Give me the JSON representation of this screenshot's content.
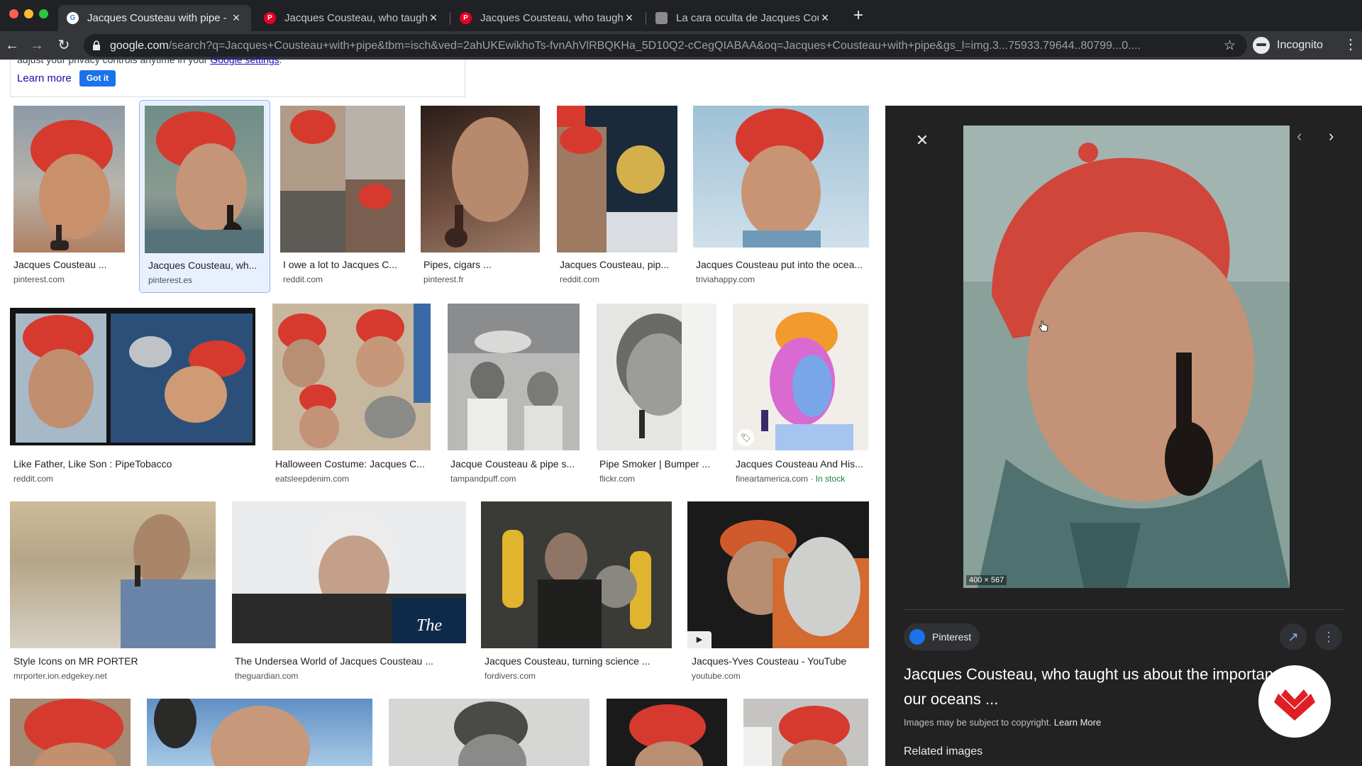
{
  "browser": {
    "tabs": [
      {
        "title": "Jacques Cousteau with pipe - Google Search",
        "favicon": "google-icon",
        "active": true
      },
      {
        "title": "Jacques Cousteau, who taught us about the importance of our oceans",
        "favicon": "pinterest-icon",
        "active": false
      },
      {
        "title": "Jacques Cousteau, who taught us about the importance of our oceans",
        "favicon": "pinterest-icon",
        "active": false
      },
      {
        "title": "La cara oculta de Jacques Cousteau",
        "favicon": "site-icon",
        "active": false
      }
    ],
    "new_tab_symbol": "+",
    "url_host": "google.com",
    "url_path": "/search?q=Jacques+Cousteau+with+pipe&tbm=isch&ved=2ahUKEwikhoTs-fvnAhVlRBQKHa_5D10Q2-cCegQIABAA&oq=Jacques+Cousteau+with+pipe&gs_l=img.3...75933.79644..80799...0....",
    "profile_label": "Incognito"
  },
  "notice": {
    "text_before_link": "adjust your privacy controls anytime in your ",
    "link_text": "Google settings",
    "text_after_link": ".",
    "learn_more": "Learn more",
    "got_it": "Got it"
  },
  "results": [
    {
      "caption": "Jacques Cousteau ...",
      "source": "pinterest.com",
      "selected": false
    },
    {
      "caption": "Jacques Cousteau, wh...",
      "source": "pinterest.es",
      "selected": true
    },
    {
      "caption": "I owe a lot to Jacques C...",
      "source": "reddit.com"
    },
    {
      "caption": "Pipes, cigars ...",
      "source": "pinterest.fr"
    },
    {
      "caption": "Jacques Cousteau, pip...",
      "source": "reddit.com"
    },
    {
      "caption": "Jacques Cousteau put into the ocea...",
      "source": "triviahappy.com"
    },
    {
      "caption": "Like Father, Like Son : PipeTobacco",
      "source": "reddit.com"
    },
    {
      "caption": "Halloween Costume: Jacques C...",
      "source": "eatsleepdenim.com"
    },
    {
      "caption": "Jacque Cousteau & pipe s...",
      "source": "tampandpuff.com"
    },
    {
      "caption": "Pipe Smoker | Bumper ...",
      "source": "flickr.com"
    },
    {
      "caption": "Jacques Cousteau And His...",
      "source": "fineartamerica.com",
      "stock": "In stock"
    },
    {
      "caption": "Style Icons on MR PORTER",
      "source": "mrporter.ion.edgekey.net"
    },
    {
      "caption": "The Undersea World of Jacques Cousteau ...",
      "source": "theguardian.com"
    },
    {
      "caption": "Jacques Cousteau, turning science ...",
      "source": "fordivers.com"
    },
    {
      "caption": "Jacques-Yves Cousteau - YouTube",
      "source": "youtube.com",
      "video": true
    }
  ],
  "panel": {
    "dimensions": "400 × 567",
    "source_name": "Pinterest",
    "title": "Jacques Cousteau, who taught us about the importance of our oceans ...",
    "copyright": "Images may be subject to copyright.",
    "learn_more": "Learn More",
    "related": "Related images"
  },
  "colors": {
    "link": "#1a0dab",
    "accent": "#1a73e8",
    "chrome_dark": "#202124",
    "panel_bg": "#222222",
    "in_stock": "#188038",
    "beanie_red": "#d63a2f"
  }
}
